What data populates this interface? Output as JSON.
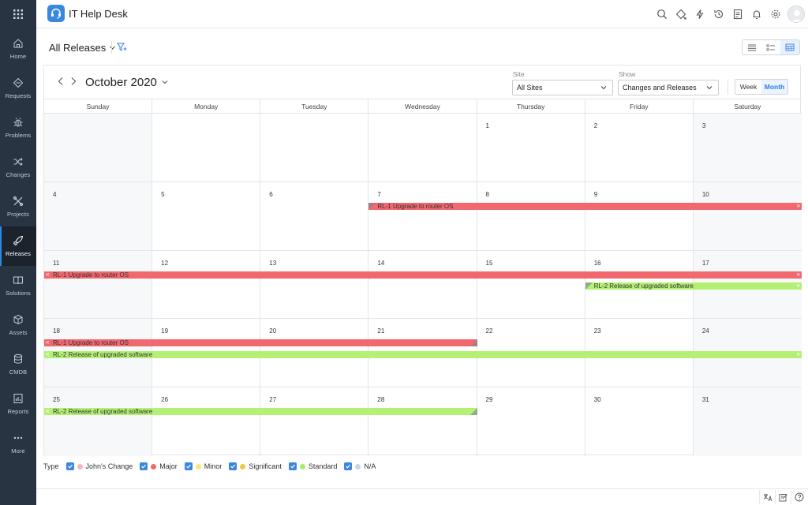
{
  "app": {
    "title": "IT Help Desk"
  },
  "sidebar": {
    "items": [
      {
        "key": "home",
        "label": "Home"
      },
      {
        "key": "requests",
        "label": "Requests"
      },
      {
        "key": "problems",
        "label": "Problems"
      },
      {
        "key": "changes",
        "label": "Changes"
      },
      {
        "key": "projects",
        "label": "Projects"
      },
      {
        "key": "releases",
        "label": "Releases",
        "active": true
      },
      {
        "key": "solutions",
        "label": "Solutions"
      },
      {
        "key": "assets",
        "label": "Assets"
      },
      {
        "key": "cmdb",
        "label": "CMDB"
      },
      {
        "key": "reports",
        "label": "Reports"
      },
      {
        "key": "more",
        "label": "More"
      }
    ]
  },
  "toolbar": {
    "view_title": "All Releases"
  },
  "calendar": {
    "month_title": "October 2020",
    "site_label": "Site",
    "site_value": "All Sites",
    "show_label": "Show",
    "show_value": "Changes and Releases",
    "week_label": "Week",
    "month_label": "Month",
    "weekdays": [
      "Sunday",
      "Monday",
      "Tuesday",
      "Wednesday",
      "Thursday",
      "Friday",
      "Saturday"
    ],
    "weeks": [
      [
        "",
        "",
        "",
        "",
        "1",
        "2",
        "3"
      ],
      [
        "4",
        "5",
        "6",
        "7",
        "8",
        "9",
        "10"
      ],
      [
        "11",
        "12",
        "13",
        "14",
        "15",
        "16",
        "17"
      ],
      [
        "18",
        "19",
        "20",
        "21",
        "22",
        "23",
        "24"
      ],
      [
        "25",
        "26",
        "27",
        "28",
        "29",
        "30",
        "31"
      ]
    ],
    "events": [
      {
        "week": 1,
        "lane": 0,
        "start": 3,
        "end": 7,
        "label": "RL-1 Upgrade to router OS",
        "color": "red",
        "starts_here": true,
        "ends_here": false
      },
      {
        "week": 2,
        "lane": 0,
        "start": 0,
        "end": 7,
        "label": "RL-1 Upgrade to router OS",
        "color": "red",
        "starts_here": false,
        "ends_here": false
      },
      {
        "week": 2,
        "lane": 1,
        "start": 5,
        "end": 7,
        "label": "RL-2 Release of upgraded software",
        "color": "green",
        "starts_here": true,
        "ends_here": false
      },
      {
        "week": 3,
        "lane": 0,
        "start": 0,
        "end": 4,
        "label": "RL-1 Upgrade to router OS",
        "color": "red",
        "starts_here": false,
        "ends_here": true
      },
      {
        "week": 3,
        "lane": 1,
        "start": 0,
        "end": 7,
        "label": "RL-2 Release of upgraded software",
        "color": "green",
        "starts_here": false,
        "ends_here": false
      },
      {
        "week": 4,
        "lane": 0,
        "start": 0,
        "end": 4,
        "label": "RL-2 Release of upgraded software",
        "color": "green",
        "starts_here": false,
        "ends_here": true
      }
    ]
  },
  "legend": {
    "type_label": "Type",
    "items": [
      {
        "label": "John's Change",
        "color": "#f3b6c8"
      },
      {
        "label": "Major",
        "color": "#f2686f"
      },
      {
        "label": "Minor",
        "color": "#f7e874"
      },
      {
        "label": "Significant",
        "color": "#f6c342"
      },
      {
        "label": "Standard",
        "color": "#a6ec6c"
      },
      {
        "label": "N/A",
        "color": "#c9d6e8"
      }
    ]
  },
  "colors": {
    "accent": "#2f7de1",
    "sidebar": "#283442",
    "release_major": "#f2686f",
    "release_standard": "#b3f074"
  }
}
